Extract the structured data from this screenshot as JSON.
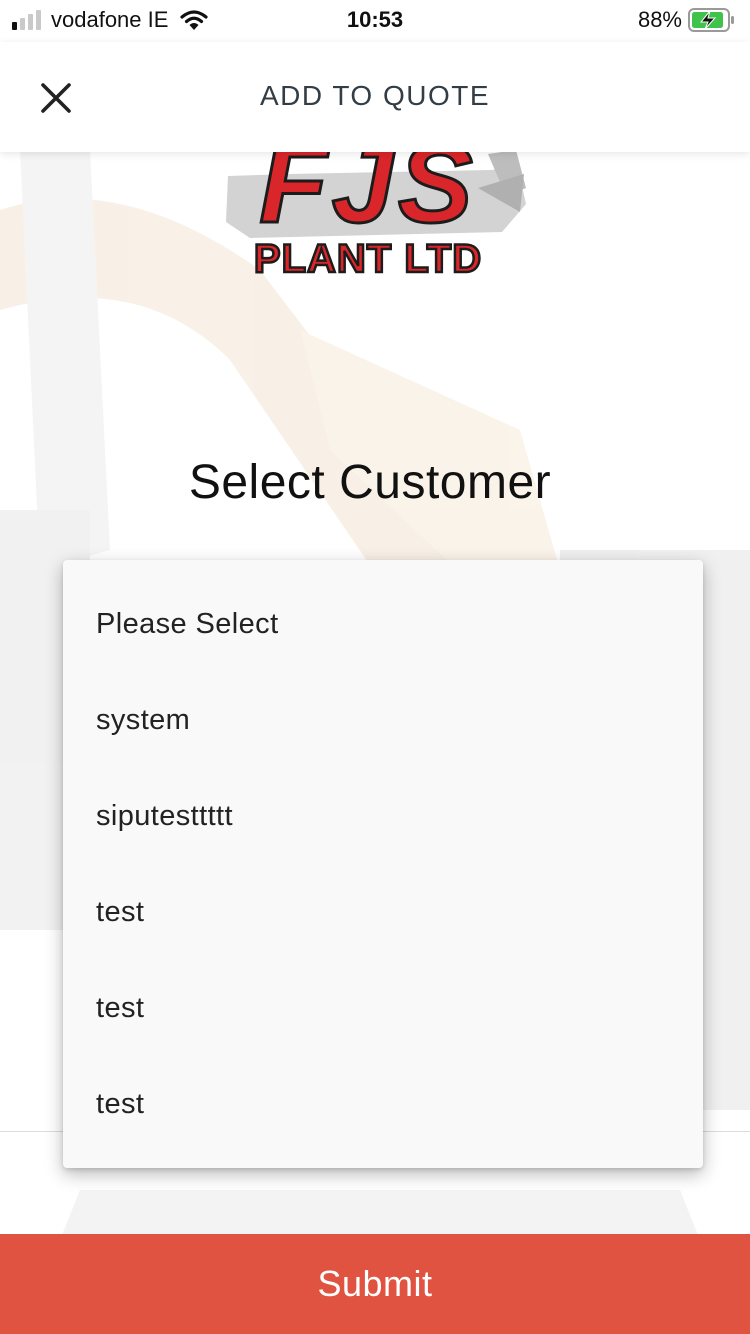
{
  "status_bar": {
    "carrier": "vodafone IE",
    "time": "10:53",
    "battery_percent": "88%",
    "signal_bars_active": 1,
    "signal_bars_total": 4,
    "battery_level": 0.88,
    "charging": true
  },
  "header": {
    "title": "ADD TO QUOTE",
    "close_icon": "close-icon"
  },
  "logo": {
    "line1": "FJS",
    "line2": "PLANT LTD",
    "brand_red": "#d9262a"
  },
  "main": {
    "select_title": "Select Customer"
  },
  "dropdown": {
    "options": [
      "Please Select",
      "system",
      "siputesttttt",
      "test",
      "test",
      "test"
    ]
  },
  "footer": {
    "submit_label": "Submit",
    "accent": "#e05340"
  }
}
